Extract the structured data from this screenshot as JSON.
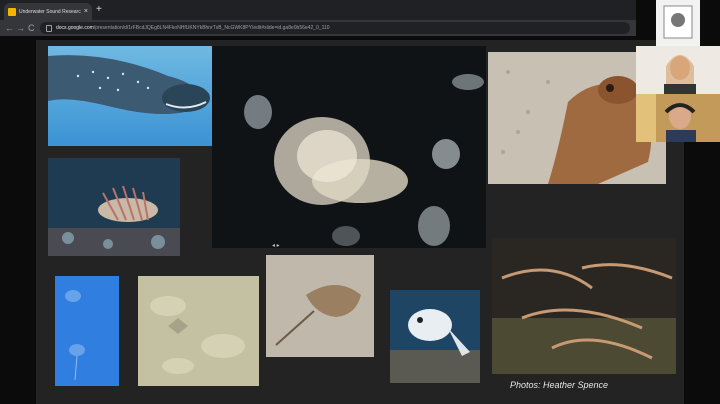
{
  "browser": {
    "tab_title": "Underwater Sound Research Mi",
    "tab_close": "×",
    "new_tab": "+",
    "nav_back": "←",
    "nav_forward": "→",
    "nav_reload": "C",
    "url_host": "docs.google.com",
    "url_path": "/presentation/d/1rFBcdJQEg8LN4FkoNHfUKNYkBhnrTxB_NcGWK8PY/edit#slide=id.ga8e0b56e42_0_110"
  },
  "slide": {
    "credit": "Photos: Heather Spence",
    "nav_indicator": "◂ ▸"
  },
  "photos": [
    {
      "subject": "whale-shark"
    },
    {
      "subject": "jellyfish"
    },
    {
      "subject": "octopus"
    },
    {
      "subject": "lionfish"
    },
    {
      "subject": "small-jellyfish"
    },
    {
      "subject": "stingray-in-sand"
    },
    {
      "subject": "horseshoe-crab"
    },
    {
      "subject": "pufferfish"
    },
    {
      "subject": "spiny-lobsters"
    }
  ]
}
